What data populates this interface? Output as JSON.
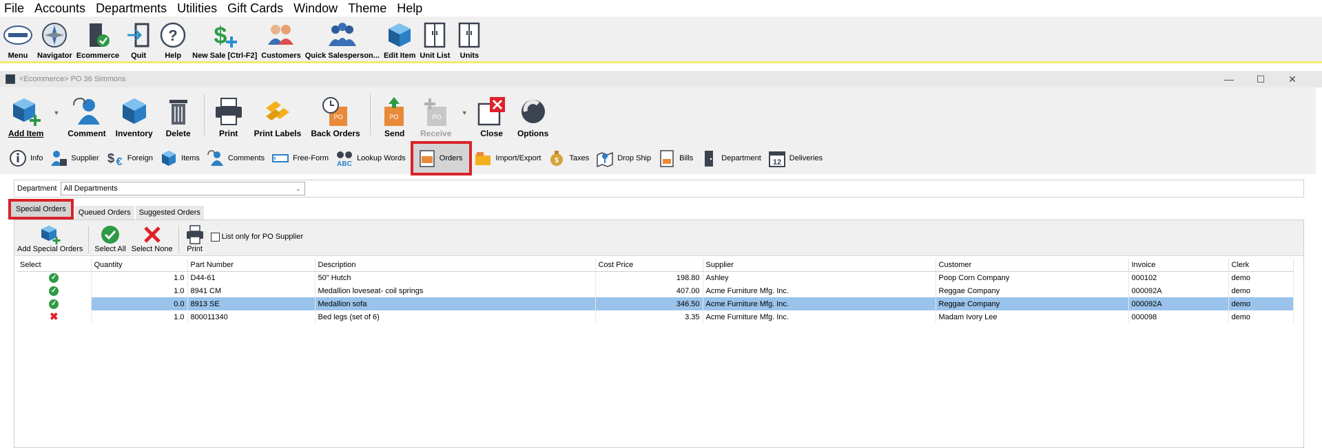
{
  "menu": [
    "File",
    "Accounts",
    "Departments",
    "Utilities",
    "Gift Cards",
    "Window",
    "Theme",
    "Help"
  ],
  "main_toolbar": [
    {
      "label": "Menu",
      "icon": "logo-icon"
    },
    {
      "label": "Navigator",
      "icon": "compass-icon"
    },
    {
      "label": "Ecommerce",
      "icon": "door-check-icon"
    },
    {
      "label": "Quit",
      "icon": "exit-icon"
    },
    {
      "label": "Help",
      "icon": "help-icon"
    },
    {
      "label": "New Sale [Ctrl-F2]",
      "icon": "dollar-plus-icon"
    },
    {
      "label": "Customers",
      "icon": "customers-icon"
    },
    {
      "label": "Quick Salesperson...",
      "icon": "group-icon"
    },
    {
      "label": "Edit Item",
      "icon": "box-icon"
    },
    {
      "label": "Unit List",
      "icon": "cabinet-icon"
    },
    {
      "label": "Units",
      "icon": "cabinet-icon"
    }
  ],
  "window": {
    "title": "<Ecommerce> PO 36 Simmons",
    "minimize": "—",
    "maximize": "☐",
    "close": "✕"
  },
  "window_toolbar": {
    "add_item": "Add Item",
    "comment": "Comment",
    "inventory": "Inventory",
    "delete": "Delete",
    "print": "Print",
    "print_labels": "Print Labels",
    "back_orders": "Back Orders",
    "send": "Send",
    "receive": "Receive",
    "close": "Close",
    "options": "Options"
  },
  "tabs": [
    "Info",
    "Supplier",
    "Foreign",
    "Items",
    "Comments",
    "Free-Form",
    "Lookup Words",
    "Orders",
    "Import/Export",
    "Taxes",
    "Drop Ship",
    "Bills",
    "Department",
    "Deliveries"
  ],
  "active_tab": "Orders",
  "department": {
    "label": "Department",
    "value": "All Departments"
  },
  "subtabs": [
    "Special Orders",
    "Queued Orders",
    "Suggested Orders"
  ],
  "panel_toolbar": {
    "add_special_orders": "Add Special Orders",
    "select_all": "Select All",
    "select_none": "Select None",
    "print": "Print",
    "list_only": "List only for PO Supplier"
  },
  "grid": {
    "columns": [
      "Select",
      "Quantity",
      "Part Number",
      "Description",
      "Cost Price",
      "Supplier",
      "Customer",
      "Invoice",
      "Clerk"
    ],
    "rows": [
      {
        "select": "check",
        "quantity": "1.0",
        "part": "D44-61",
        "desc": "50\" Hutch",
        "cost": "198.80",
        "supplier": "Ashley",
        "customer": "Poop Corn Company",
        "invoice": "000102",
        "clerk": "demo"
      },
      {
        "select": "check",
        "quantity": "1.0",
        "part": "8941 CM",
        "desc": "Medallion loveseat- coil springs",
        "cost": "407.00",
        "supplier": "Acme Furniture Mfg. Inc.",
        "customer": "Reggae Company",
        "invoice": "000092A",
        "clerk": "demo"
      },
      {
        "select": "check",
        "quantity": "0.0",
        "part": "8913 SE",
        "desc": "Medallion sofa",
        "cost": "346.50",
        "supplier": "Acme Furniture Mfg. Inc.",
        "customer": "Reggae Company",
        "invoice": "000092A",
        "clerk": "demo"
      },
      {
        "select": "x",
        "quantity": "1.0",
        "part": "800011340",
        "desc": "Bed legs (set of 6)",
        "cost": "3.35",
        "supplier": "Acme Furniture Mfg. Inc.",
        "customer": "Madam Ivory Lee",
        "invoice": "000098",
        "clerk": "demo"
      }
    ]
  }
}
